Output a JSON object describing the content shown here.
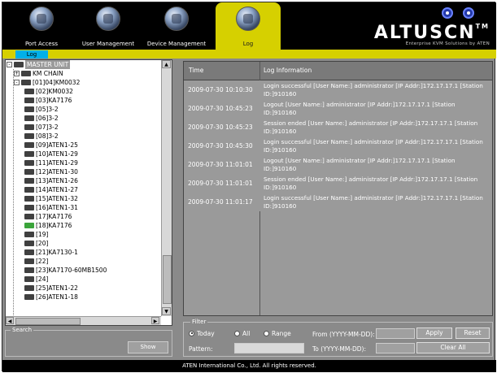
{
  "nav": {
    "tabs": [
      {
        "label": "Port Access",
        "icon": "port-access-icon"
      },
      {
        "label": "User Management",
        "icon": "user-management-icon"
      },
      {
        "label": "Device Management",
        "icon": "device-management-icon"
      },
      {
        "label": "Log",
        "icon": "log-icon"
      }
    ],
    "active_tab": "Log",
    "subtab": "Log",
    "brand": "ALTUSCN",
    "brand_mark": "TM",
    "tagline": "Enterprise KVM Solutions by ATEN"
  },
  "colors": {
    "accent": "#d6d000",
    "subtab": "#00b0e8",
    "panel": "#8a8a8a"
  },
  "tree": {
    "items": [
      {
        "label": "MASTER UNIT",
        "level": 0,
        "expander": "-"
      },
      {
        "label": "KM CHAIN",
        "level": 1,
        "expander": "+"
      },
      {
        "label": "[01]04]KM0032",
        "level": 1,
        "expander": "-"
      },
      {
        "label": "[02]KM0032",
        "level": 2
      },
      {
        "label": "[03]KA7176",
        "level": 2
      },
      {
        "label": "[05]3-2",
        "level": 2
      },
      {
        "label": "[06]3-2",
        "level": 2
      },
      {
        "label": "[07]3-2",
        "level": 2
      },
      {
        "label": "[08]3-2",
        "level": 2
      },
      {
        "label": "[09]ATEN1-25",
        "level": 2
      },
      {
        "label": "[10]ATEN1-29",
        "level": 2
      },
      {
        "label": "[11]ATEN1-29",
        "level": 2
      },
      {
        "label": "[12]ATEN1-30",
        "level": 2
      },
      {
        "label": "[13]ATEN1-26",
        "level": 2
      },
      {
        "label": "[14]ATEN1-27",
        "level": 2
      },
      {
        "label": "[15]ATEN1-32",
        "level": 2
      },
      {
        "label": "[16]ATEN1-31",
        "level": 2
      },
      {
        "label": "[17]KA7176",
        "level": 2
      },
      {
        "label": "[18]KA7176",
        "level": 2,
        "green": true
      },
      {
        "label": "[19]",
        "level": 2
      },
      {
        "label": "[20]",
        "level": 2
      },
      {
        "label": "[21]KA7130-1",
        "level": 2
      },
      {
        "label": "[22]",
        "level": 2
      },
      {
        "label": "[23]KA7170-60MB1500",
        "level": 2
      },
      {
        "label": "[24]",
        "level": 2
      },
      {
        "label": "[25]ATEN1-22",
        "level": 2
      },
      {
        "label": "[26]ATEN1-18",
        "level": 2
      }
    ]
  },
  "search": {
    "label": "Search",
    "show_label": "Show",
    "value": ""
  },
  "log": {
    "headers": {
      "time": "Time",
      "info": "Log Information"
    },
    "rows": [
      {
        "time": "2009-07-30 10:10:30",
        "info": "Login successful [User Name:] administrator [IP Addr:]172.17.17.1 [Station ID:]910160"
      },
      {
        "time": "2009-07-30 10:45:23",
        "info": "Logout [User Name:] administrator [IP Addr:]172.17.17.1 [Station ID:]910160"
      },
      {
        "time": "2009-07-30 10:45:23",
        "info": "Session ended [User Name:] administrator [IP Addr:]172.17.17.1 [Station ID:]910160"
      },
      {
        "time": "2009-07-30 10:45:30",
        "info": "Login successful [User Name:] administrator [IP Addr:]172.17.17.1 [Station ID:]910160"
      },
      {
        "time": "2009-07-30 11:01:01",
        "info": "Logout [User Name:] administrator [IP Addr:]172.17.17.1 [Station ID:]910160"
      },
      {
        "time": "2009-07-30 11:01:01",
        "info": "Session ended [User Name:] administrator [IP Addr:]172.17.17.1 [Station ID:]910160"
      },
      {
        "time": "2009-07-30 11:01:17",
        "info": "Login successful [User Name:] administrator [IP Addr:]172.17.17.1 [Station ID:]910160"
      }
    ]
  },
  "filter": {
    "label": "Filter",
    "options": [
      "Today",
      "All",
      "Range"
    ],
    "selected": "Today",
    "from_label": "From (YYYY-MM-DD):",
    "to_label": "To (YYYY-MM-DD):",
    "pattern_label": "Pattern:",
    "pattern_value": "",
    "from_value": "",
    "to_value": "",
    "apply_label": "Apply",
    "reset_label": "Reset",
    "clear_all_label": "Clear All"
  },
  "footer": {
    "copyright": "ATEN International Co., Ltd. All rights reserved."
  }
}
